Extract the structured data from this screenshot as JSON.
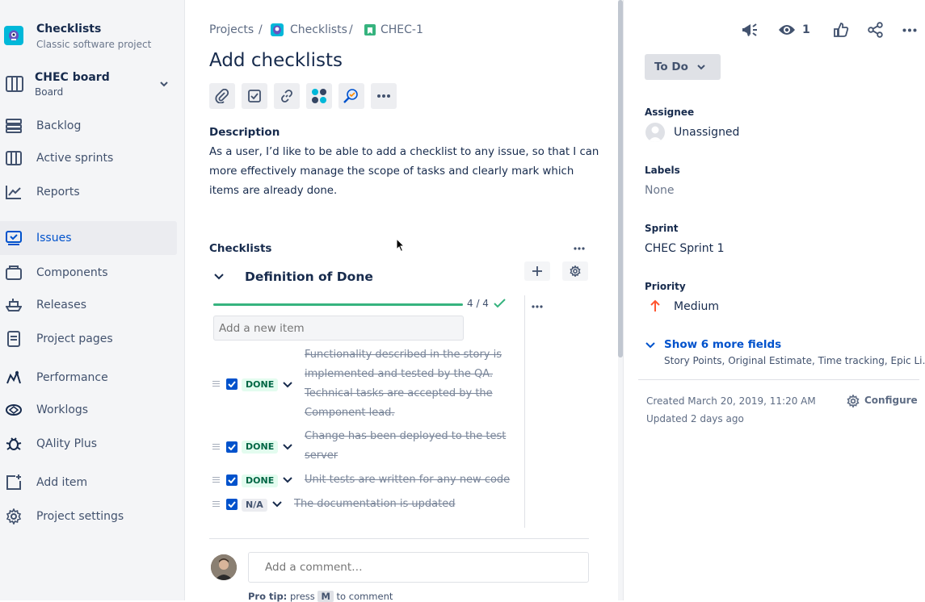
{
  "sidebar": {
    "project_name": "Checklists",
    "project_type": "Classic software project",
    "board_name": "CHEC board",
    "board_sub": "Board",
    "items": [
      {
        "label": "Backlog"
      },
      {
        "label": "Active sprints"
      },
      {
        "label": "Reports"
      },
      {
        "label": "Issues"
      },
      {
        "label": "Components"
      },
      {
        "label": "Releases"
      },
      {
        "label": "Project pages"
      },
      {
        "label": "Performance"
      },
      {
        "label": "Worklogs"
      },
      {
        "label": "QAlity Plus"
      },
      {
        "label": "Add item"
      },
      {
        "label": "Project settings"
      }
    ]
  },
  "breadcrumb": {
    "projects": "Projects",
    "sep": "/",
    "project": "Checklists",
    "issue_key": "CHEC-1"
  },
  "issue": {
    "title": "Add checklists",
    "description_label": "Description",
    "description_lines": [
      "As a user, I’d like to be able to add a checklist to any issue, so that I can",
      "more effectively manage the scope of tasks and clearly mark which",
      "items are already done."
    ]
  },
  "checklists": {
    "section_title": "Checklists",
    "list_title": "Definition of Done",
    "progress_text": "4 / 4",
    "progress": 1.0,
    "add_placeholder": "Add a new item",
    "items": [
      {
        "status": "DONE",
        "lines": [
          "Functionality described in the story is",
          "implemented and tested by the QA.",
          "Technical tasks are accepted by the",
          "Component lead."
        ]
      },
      {
        "status": "DONE",
        "lines": [
          "Change has been deployed to the test",
          "server"
        ]
      },
      {
        "status": "DONE",
        "lines": [
          "Unit tests are written for any new code"
        ]
      },
      {
        "status": "N/A",
        "lines": [
          "The documentation is updated"
        ]
      }
    ]
  },
  "comment": {
    "placeholder": "Add a comment…",
    "pro_tip_label": "Pro tip:",
    "pro_tip_press": "press",
    "pro_tip_key": "M",
    "pro_tip_rest": "to comment"
  },
  "header_actions": {
    "watch_count": "1"
  },
  "status": {
    "label": "To Do"
  },
  "fields": {
    "assignee_label": "Assignee",
    "assignee_value": "Unassigned",
    "labels_label": "Labels",
    "labels_value": "None",
    "sprint_label": "Sprint",
    "sprint_value": "CHEC Sprint 1",
    "priority_label": "Priority",
    "priority_value": "Medium",
    "show_more": "Show 6 more fields",
    "more_fields_list": "Story Points, Original Estimate, Time tracking, Epic Li…"
  },
  "meta": {
    "created": "Created March 20, 2019, 11:20 AM",
    "updated": "Updated 2 days ago",
    "configure": "Configure"
  },
  "colors": {
    "accent": "#0052CC",
    "progress": "#36B37E",
    "priority_medium": "#FF5630"
  }
}
